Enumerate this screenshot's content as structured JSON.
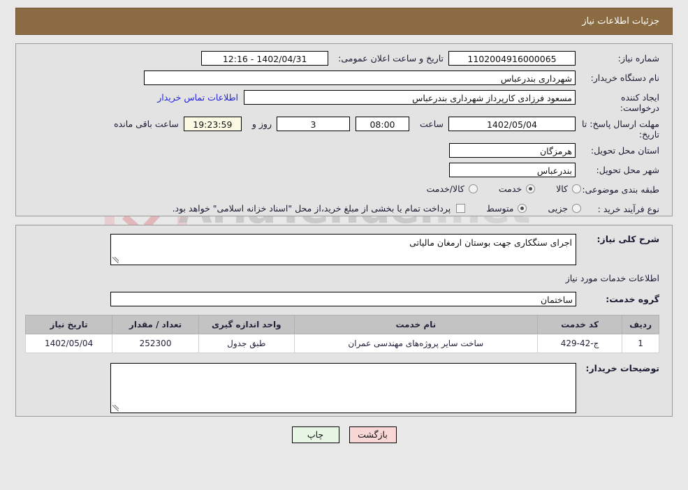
{
  "header": {
    "title": "جزئیات اطلاعات نیاز"
  },
  "watermark": {
    "text_main": "AriaTender",
    "text_suffix": ".net"
  },
  "form": {
    "need_number": {
      "label": "شماره نیاز:",
      "value": "1102004916000065"
    },
    "public_announce": {
      "label": "تاریخ و ساعت اعلان عمومی:",
      "value": "1402/04/31 - 12:16"
    },
    "buyer_org": {
      "label": "نام دستگاه خریدار:",
      "value": "شهرداری بندرعباس"
    },
    "creator": {
      "label": "ایجاد کننده درخواست:",
      "value": "مسعود فرزادی کارپرداز شهرداری بندرعباس"
    },
    "contact_link": "اطلاعات تماس خریدار",
    "deadline": {
      "label": "مهلت ارسال پاسخ: تا تاریخ:",
      "date": "1402/05/04",
      "time_label": "ساعت",
      "time": "08:00",
      "days": "3",
      "days_label": "روز و",
      "timer": "19:23:59",
      "timer_label": "ساعت باقی مانده"
    },
    "province": {
      "label": "استان محل تحویل:",
      "value": "هرمزگان"
    },
    "city": {
      "label": "شهر محل تحویل:",
      "value": "بندرعباس"
    },
    "category": {
      "label": "طبقه بندی موضوعی:",
      "options": [
        {
          "label": "کالا",
          "selected": false
        },
        {
          "label": "خدمت",
          "selected": true
        },
        {
          "label": "کالا/خدمت",
          "selected": false
        }
      ]
    },
    "process_type": {
      "label": "نوع فرآیند خرید :",
      "options": [
        {
          "label": "جزیی",
          "selected": false
        },
        {
          "label": "متوسط",
          "selected": true
        }
      ],
      "checkbox_checked": false,
      "note": "پرداخت تمام یا بخشی از مبلغ خرید،از محل \"اسناد خزانه اسلامی\" خواهد بود."
    }
  },
  "details": {
    "need_description": {
      "label": "شرح کلی نیاز:",
      "value": "اجرای سنگکاری جهت بوستان ارمغان مالیاتی"
    },
    "section_title": "اطلاعات خدمات مورد نیاز",
    "service_group": {
      "label": "گروه خدمت:",
      "value": "ساختمان"
    },
    "table": {
      "columns": [
        "ردیف",
        "کد خدمت",
        "نام خدمت",
        "واحد اندازه گیری",
        "تعداد / مقدار",
        "تاریخ نیاز"
      ],
      "rows": [
        {
          "row_no": "1",
          "service_code": "ج-42-429",
          "service_name": "ساخت سایر پروژه‌های مهندسی عمران",
          "unit": "طبق جدول",
          "quantity": "252300",
          "need_date": "1402/05/04"
        }
      ]
    },
    "buyer_notes": {
      "label": "توضیحات خریدار:",
      "value": ""
    }
  },
  "footer": {
    "back_button": "بازگشت",
    "print_button": "چاپ"
  },
  "colors": {
    "header_bg": "#8a6b42",
    "page_bg": "#e8e8e8",
    "panel_bg": "#e3e3e3",
    "link": "#2222dd",
    "timer_bg": "#fbfbe4",
    "back_btn_bg": "#f9d7d7",
    "print_btn_bg": "#e8f6e6",
    "table_header_bg": "#c3c3c3"
  }
}
